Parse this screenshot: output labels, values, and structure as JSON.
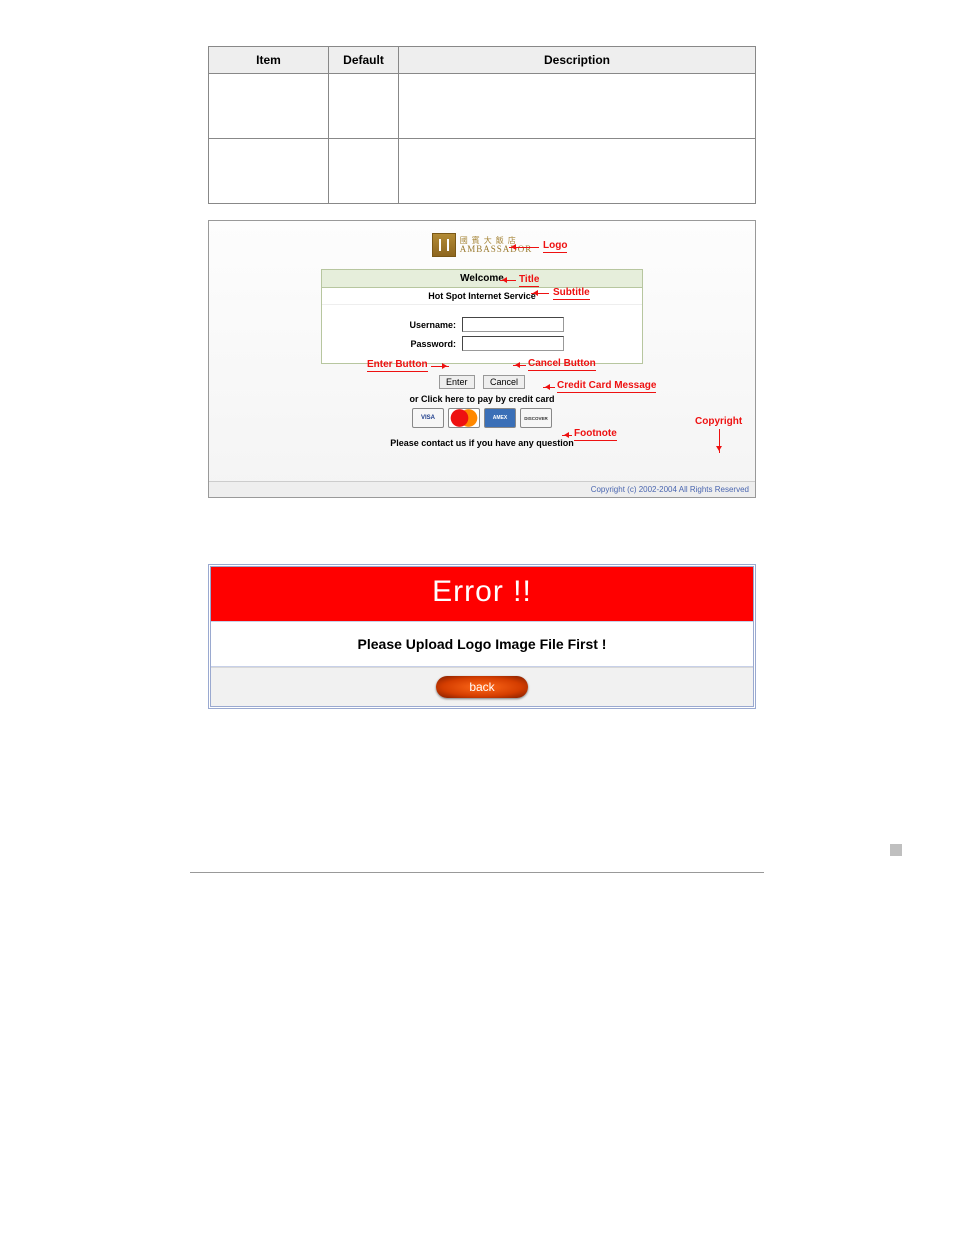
{
  "table": {
    "headers": {
      "item": "Item",
      "default": "Default",
      "description": "Description"
    }
  },
  "login": {
    "brand_cjk": "國 賓 大 飯 店",
    "brand_en": "AMBASSADOR",
    "title": "Welcome",
    "subtitle": "Hot Spot Internet Service",
    "username_label": "Username:",
    "password_label": "Password:",
    "enter_label": "Enter",
    "cancel_label": "Cancel",
    "credit_msg": "or Click here to pay by credit card",
    "cards": {
      "visa": "VISA",
      "amex": "AMEX",
      "discover": "DISCOVER"
    },
    "footnote": "Please contact us if you have any question",
    "copyright": "Copyright (c) 2002-2004 All Rights Reserved"
  },
  "annotations": {
    "logo": "Logo",
    "title": "Title",
    "subtitle": "Subtitle",
    "enter": "Enter Button",
    "cancel": "Cancel Button",
    "credit": "Credit Card Message",
    "footnote": "Footnote",
    "copyright": "Copyright"
  },
  "error": {
    "heading": "Error !!",
    "message": "Please Upload Logo Image File First !",
    "back": "back"
  }
}
